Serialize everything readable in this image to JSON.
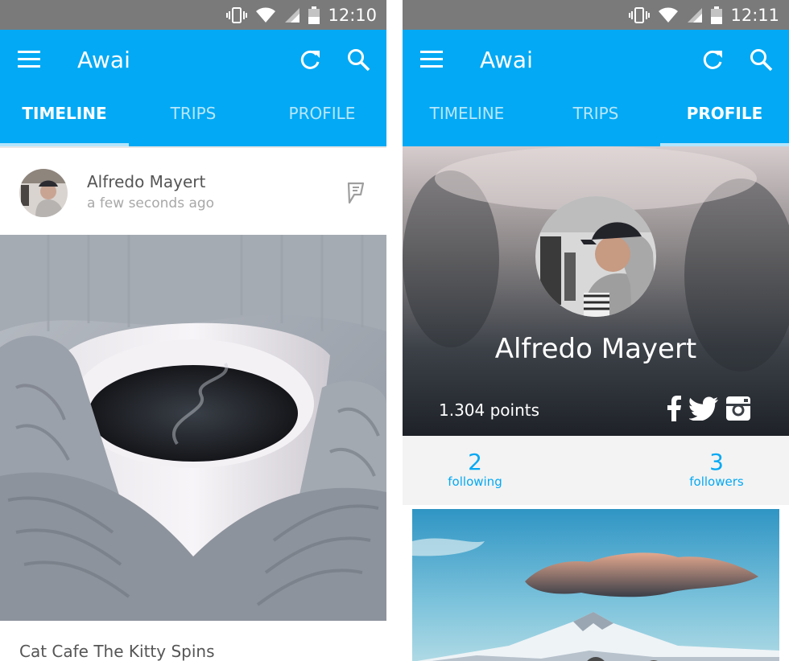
{
  "screens": [
    {
      "status_time": "12:10",
      "app_title": "Awai",
      "tabs": [
        "TIMELINE",
        "TRIPS",
        "PROFILE"
      ],
      "active_tab": "TIMELINE",
      "post": {
        "author": "Alfredo Mayert",
        "time_ago": "a few seconds ago",
        "caption": "Cat Cafe The Kitty Spins"
      }
    },
    {
      "status_time": "12:11",
      "app_title": "Awai",
      "tabs": [
        "TIMELINE",
        "TRIPS",
        "PROFILE"
      ],
      "active_tab": "PROFILE",
      "profile": {
        "name": "Alfredo Mayert",
        "points": "1.304 points",
        "following_count": "2",
        "following_label": "following",
        "followers_count": "3",
        "followers_label": "followers"
      }
    }
  ],
  "icons": {
    "menu": "menu-icon",
    "refresh": "refresh-icon",
    "search": "search-icon",
    "post_type": "foursquare-icon",
    "social": [
      "facebook-icon",
      "twitter-icon",
      "instagram-icon"
    ]
  },
  "colors": {
    "primary": "#03a9f4",
    "status_bar": "#7a7a7a",
    "tab_indicator": "#b3e5fc"
  }
}
